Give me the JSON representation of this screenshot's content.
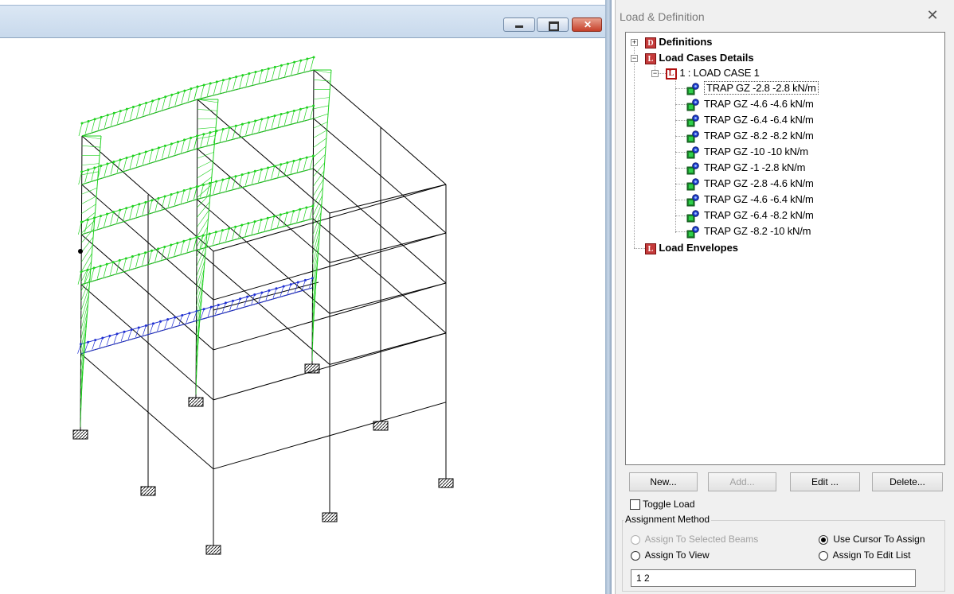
{
  "panel": {
    "title": "Load & Definition",
    "close_glyph": "✕",
    "tree": {
      "definitions": {
        "icon": "D",
        "label": "Definitions"
      },
      "load_cases_details": {
        "icon": "L",
        "label": "Load Cases Details"
      },
      "load_case": {
        "icon": "L",
        "label": "1 : LOAD CASE 1"
      },
      "loads": [
        "TRAP GZ -2.8 -2.8 kN/m",
        "TRAP GZ -4.6 -4.6 kN/m",
        "TRAP GZ -6.4 -6.4 kN/m",
        "TRAP GZ -8.2 -8.2 kN/m",
        "TRAP GZ -10 -10 kN/m",
        "TRAP GZ -1 -2.8 kN/m",
        "TRAP GZ -2.8 -4.6 kN/m",
        "TRAP GZ -4.6 -6.4 kN/m",
        "TRAP GZ -6.4 -8.2 kN/m",
        "TRAP GZ -8.2 -10 kN/m"
      ],
      "load_envelopes": {
        "icon": "L",
        "label": "Load Envelopes"
      }
    },
    "buttons": {
      "new": "New...",
      "add": "Add...",
      "edit": "Edit ...",
      "delete": "Delete..."
    },
    "toggle_load": "Toggle Load",
    "assignment_method": {
      "label": "Assignment Method",
      "selected_beams": "Assign To Selected Beams",
      "view": "Assign To View",
      "cursor": "Use Cursor To Assign",
      "edit_list": "Assign To Edit List",
      "selected": "Use Cursor To Assign"
    },
    "edit_list_value": "1 2"
  },
  "colors": {
    "load_green": "#1fd11f",
    "load_blue": "#1f2fd1",
    "accent_red": "#c43a3a"
  }
}
